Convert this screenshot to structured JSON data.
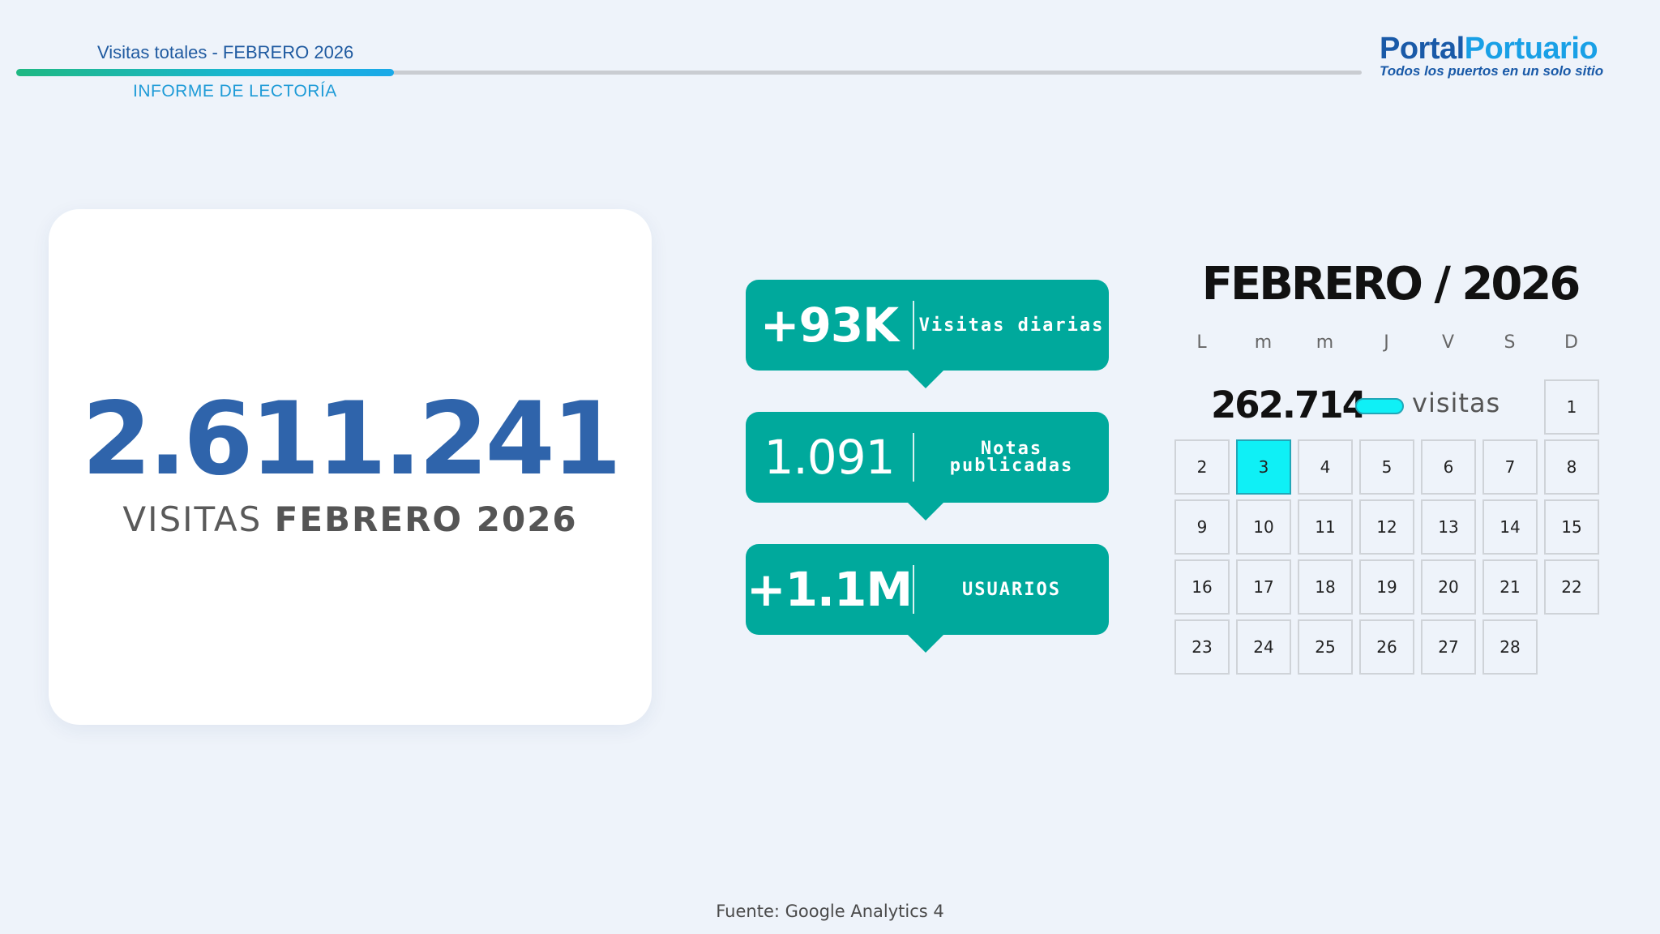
{
  "header": {
    "title": "Visitas totales - FEBRERO 2026",
    "subtitle": "INFORME DE LECTORÍA"
  },
  "logo": {
    "name_part1": "Portal",
    "name_part2": "Portuario",
    "tagline": "Todos los puertos en un solo sitio"
  },
  "summary": {
    "total_visits": "2.611.241",
    "label_regular": "VISITAS ",
    "label_bold": "FEBRERO 2026"
  },
  "stats": [
    {
      "value": "+93K",
      "label": "Visitas diarias"
    },
    {
      "value": "1.091",
      "label": "Notas publicadas"
    },
    {
      "value": "+1.1M",
      "label": "USUARIOS"
    }
  ],
  "calendar": {
    "title": "FEBRERO / 2026",
    "weekdays": [
      "L",
      "m",
      "m",
      "J",
      "V",
      "S",
      "D"
    ],
    "days": [
      "1",
      "2",
      "3",
      "4",
      "5",
      "6",
      "7",
      "8",
      "9",
      "10",
      "11",
      "12",
      "13",
      "14",
      "15",
      "16",
      "17",
      "18",
      "19",
      "20",
      "21",
      "22",
      "23",
      "24",
      "25",
      "26",
      "27",
      "28"
    ],
    "highlight_day": "3",
    "legend_value": "262.714",
    "legend_label": "visitas",
    "highlight_color": "#0ff0f6"
  },
  "footer": {
    "source": "Fuente: Google Analytics 4"
  },
  "colors": {
    "accent_teal": "#00a99c",
    "brand_blue": "#2f64ab",
    "brand_light_blue": "#19a0e6",
    "background": "#eef3fa"
  }
}
